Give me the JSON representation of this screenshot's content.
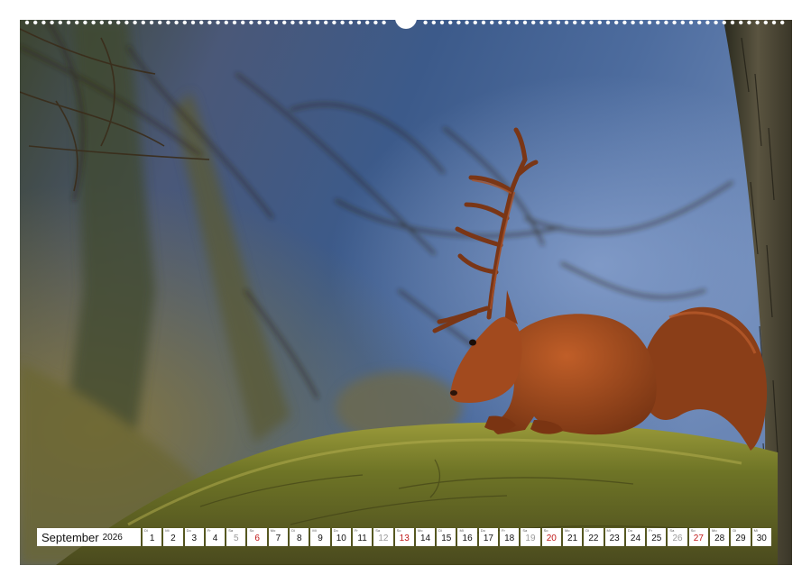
{
  "calendar": {
    "month": "September",
    "year": "2026",
    "days": [
      {
        "d": "1",
        "w": "Di",
        "t": "wd"
      },
      {
        "d": "2",
        "w": "Mi",
        "t": "wd"
      },
      {
        "d": "3",
        "w": "Do",
        "t": "wd"
      },
      {
        "d": "4",
        "w": "Fr",
        "t": "wd"
      },
      {
        "d": "5",
        "w": "Sa",
        "t": "we"
      },
      {
        "d": "6",
        "w": "So",
        "t": "sun"
      },
      {
        "d": "7",
        "w": "Mo",
        "t": "wd"
      },
      {
        "d": "8",
        "w": "Di",
        "t": "wd"
      },
      {
        "d": "9",
        "w": "Mi",
        "t": "wd"
      },
      {
        "d": "10",
        "w": "Do",
        "t": "wd"
      },
      {
        "d": "11",
        "w": "Fr",
        "t": "wd"
      },
      {
        "d": "12",
        "w": "Sa",
        "t": "we"
      },
      {
        "d": "13",
        "w": "So",
        "t": "sun"
      },
      {
        "d": "14",
        "w": "Mo",
        "t": "wd"
      },
      {
        "d": "15",
        "w": "Di",
        "t": "wd"
      },
      {
        "d": "16",
        "w": "Mi",
        "t": "wd"
      },
      {
        "d": "17",
        "w": "Do",
        "t": "wd"
      },
      {
        "d": "18",
        "w": "Fr",
        "t": "wd"
      },
      {
        "d": "19",
        "w": "Sa",
        "t": "we"
      },
      {
        "d": "20",
        "w": "So",
        "t": "sun"
      },
      {
        "d": "21",
        "w": "Mo",
        "t": "wd"
      },
      {
        "d": "22",
        "w": "Di",
        "t": "wd"
      },
      {
        "d": "23",
        "w": "Mi",
        "t": "wd"
      },
      {
        "d": "24",
        "w": "Do",
        "t": "wd"
      },
      {
        "d": "25",
        "w": "Fr",
        "t": "wd"
      },
      {
        "d": "26",
        "w": "Sa",
        "t": "we"
      },
      {
        "d": "27",
        "w": "So",
        "t": "sun"
      },
      {
        "d": "28",
        "w": "Mo",
        "t": "wd"
      },
      {
        "d": "29",
        "w": "Di",
        "t": "wd"
      },
      {
        "d": "30",
        "w": "Mi",
        "t": "wd"
      }
    ]
  },
  "colors": {
    "sunday": "#c01818",
    "saturday": "#9a9a9a",
    "weekday": "#111111"
  }
}
